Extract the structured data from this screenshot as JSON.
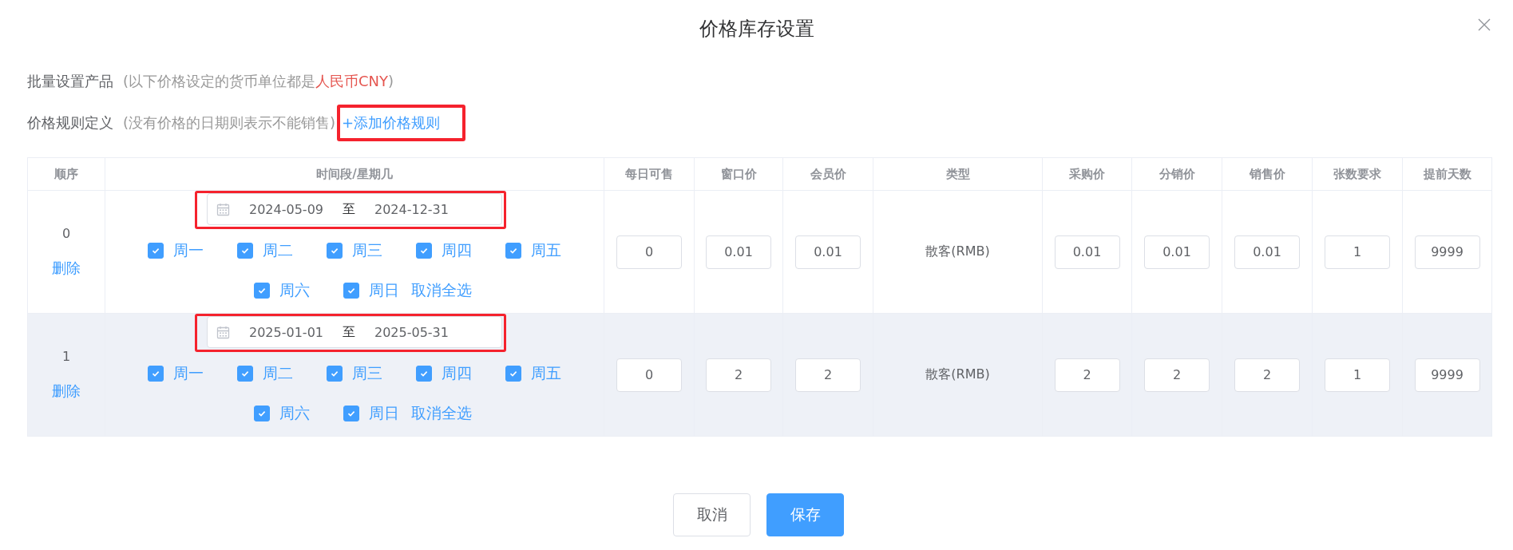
{
  "dialog": {
    "title": "价格库存设置"
  },
  "batch": {
    "label": "批量设置产品",
    "note_start": "(以下价格设定的货币单位都是",
    "currency": "人民币CNY",
    "note_end": ")"
  },
  "rules": {
    "label": "价格规则定义",
    "note": "(没有价格的日期则表示不能销售)",
    "add_link": {
      "text": "+添加价格规则",
      "highlighted": true
    }
  },
  "table": {
    "columns": [
      "顺序",
      "时间段/星期几",
      "每日可售",
      "窗口价",
      "会员价",
      "类型",
      "采购价",
      "分销价",
      "销售价",
      "张数要求",
      "提前天数"
    ],
    "rows": [
      {
        "hovered": false,
        "cells": [
          {
            "kind": "order",
            "order": "0",
            "delete": "删除"
          },
          {
            "kind": "schedule",
            "date_range": {
              "start": "2024-05-09",
              "separator": "至",
              "end": "2024-12-31",
              "highlighted": true
            },
            "weekdays": [
              {
                "label": "周一",
                "checked": true
              },
              {
                "label": "周二",
                "checked": true
              },
              {
                "label": "周三",
                "checked": true
              },
              {
                "label": "周四",
                "checked": true
              },
              {
                "label": "周五",
                "checked": true
              },
              {
                "label": "周六",
                "checked": true
              },
              {
                "label": "周日",
                "checked": true
              }
            ],
            "clear_all": "取消全选"
          },
          {
            "kind": "input",
            "value": "0"
          },
          {
            "kind": "input",
            "value": "0.01"
          },
          {
            "kind": "input",
            "value": "0.01"
          },
          {
            "kind": "text",
            "value": "散客(RMB)"
          },
          {
            "kind": "input",
            "value": "0.01"
          },
          {
            "kind": "input",
            "value": "0.01"
          },
          {
            "kind": "input",
            "value": "0.01"
          },
          {
            "kind": "input",
            "value": "1"
          },
          {
            "kind": "input",
            "value": "9999"
          }
        ]
      },
      {
        "hovered": true,
        "cells": [
          {
            "kind": "order",
            "order": "1",
            "delete": "删除"
          },
          {
            "kind": "schedule",
            "date_range": {
              "start": "2025-01-01",
              "separator": "至",
              "end": "2025-05-31",
              "highlighted": true
            },
            "weekdays": [
              {
                "label": "周一",
                "checked": true
              },
              {
                "label": "周二",
                "checked": true
              },
              {
                "label": "周三",
                "checked": true
              },
              {
                "label": "周四",
                "checked": true
              },
              {
                "label": "周五",
                "checked": true
              },
              {
                "label": "周六",
                "checked": true
              },
              {
                "label": "周日",
                "checked": true
              }
            ],
            "clear_all": "取消全选"
          },
          {
            "kind": "input",
            "value": "0"
          },
          {
            "kind": "input",
            "value": "2"
          },
          {
            "kind": "input",
            "value": "2"
          },
          {
            "kind": "text",
            "value": "散客(RMB)"
          },
          {
            "kind": "input",
            "value": "2"
          },
          {
            "kind": "input",
            "value": "2"
          },
          {
            "kind": "input",
            "value": "2"
          },
          {
            "kind": "input",
            "value": "1"
          },
          {
            "kind": "input",
            "value": "9999"
          }
        ]
      }
    ]
  },
  "buttons": [
    {
      "label": "取消",
      "kind": "default"
    },
    {
      "label": "保存",
      "kind": "primary"
    }
  ]
}
